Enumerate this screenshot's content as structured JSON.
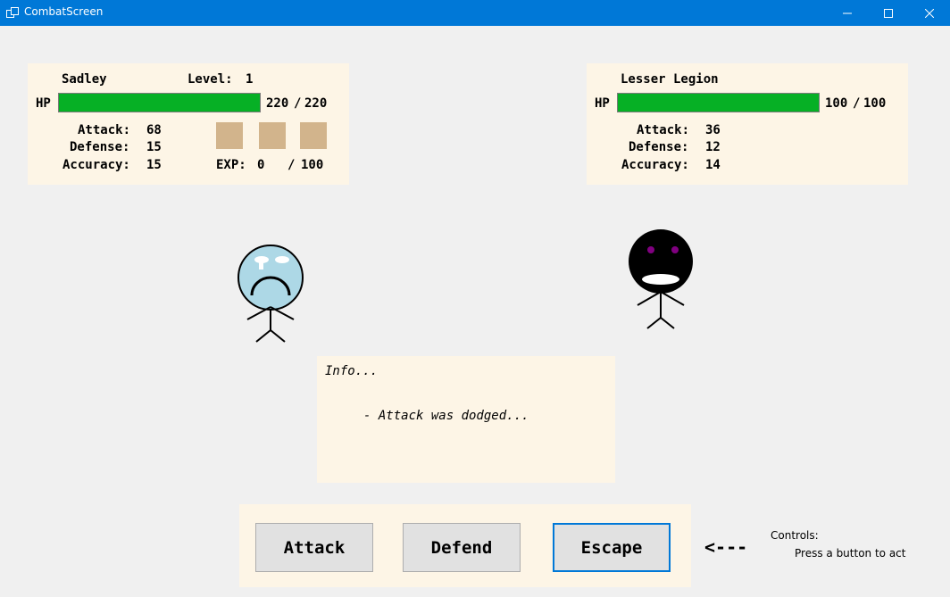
{
  "window": {
    "title": "CombatScreen"
  },
  "player": {
    "name": "Sadley",
    "level_label": "Level:",
    "level": "1",
    "hp_label": "HP",
    "hp_current": "220",
    "hp_sep": "/",
    "hp_max": "220",
    "hp_fraction": 1.0,
    "attack_label": "Attack:",
    "attack": "68",
    "defense_label": "Defense:",
    "defense": "15",
    "accuracy_label": "Accuracy:",
    "accuracy": "15",
    "exp_label": "EXP:",
    "exp_current": "0",
    "exp_sep": "/",
    "exp_max": "100",
    "inventory_slots": 3
  },
  "enemy": {
    "name": "Lesser Legion",
    "hp_label": "HP",
    "hp_current": "100",
    "hp_sep": "/",
    "hp_max": "100",
    "hp_fraction": 1.0,
    "attack_label": "Attack:",
    "attack": "36",
    "defense_label": "Defense:",
    "defense": "12",
    "accuracy_label": "Accuracy:",
    "accuracy": "14"
  },
  "info": {
    "title": "Info...",
    "message": "- Attack was dodged..."
  },
  "actions": {
    "attack": "Attack",
    "defend": "Defend",
    "escape": "Escape"
  },
  "controls": {
    "arrow": "<---",
    "title": "Controls:",
    "hint": "Press a button to act"
  },
  "colors": {
    "titlebar": "#0078d7",
    "hp_fill": "#06b025",
    "panel": "#fdf5e6",
    "slot": "#d2b48c",
    "player_face": "#add8e6",
    "enemy_face": "#000000",
    "enemy_eyes": "#800080"
  },
  "icons": [
    "app-icon",
    "minimize-icon",
    "maximize-icon",
    "close-icon"
  ]
}
